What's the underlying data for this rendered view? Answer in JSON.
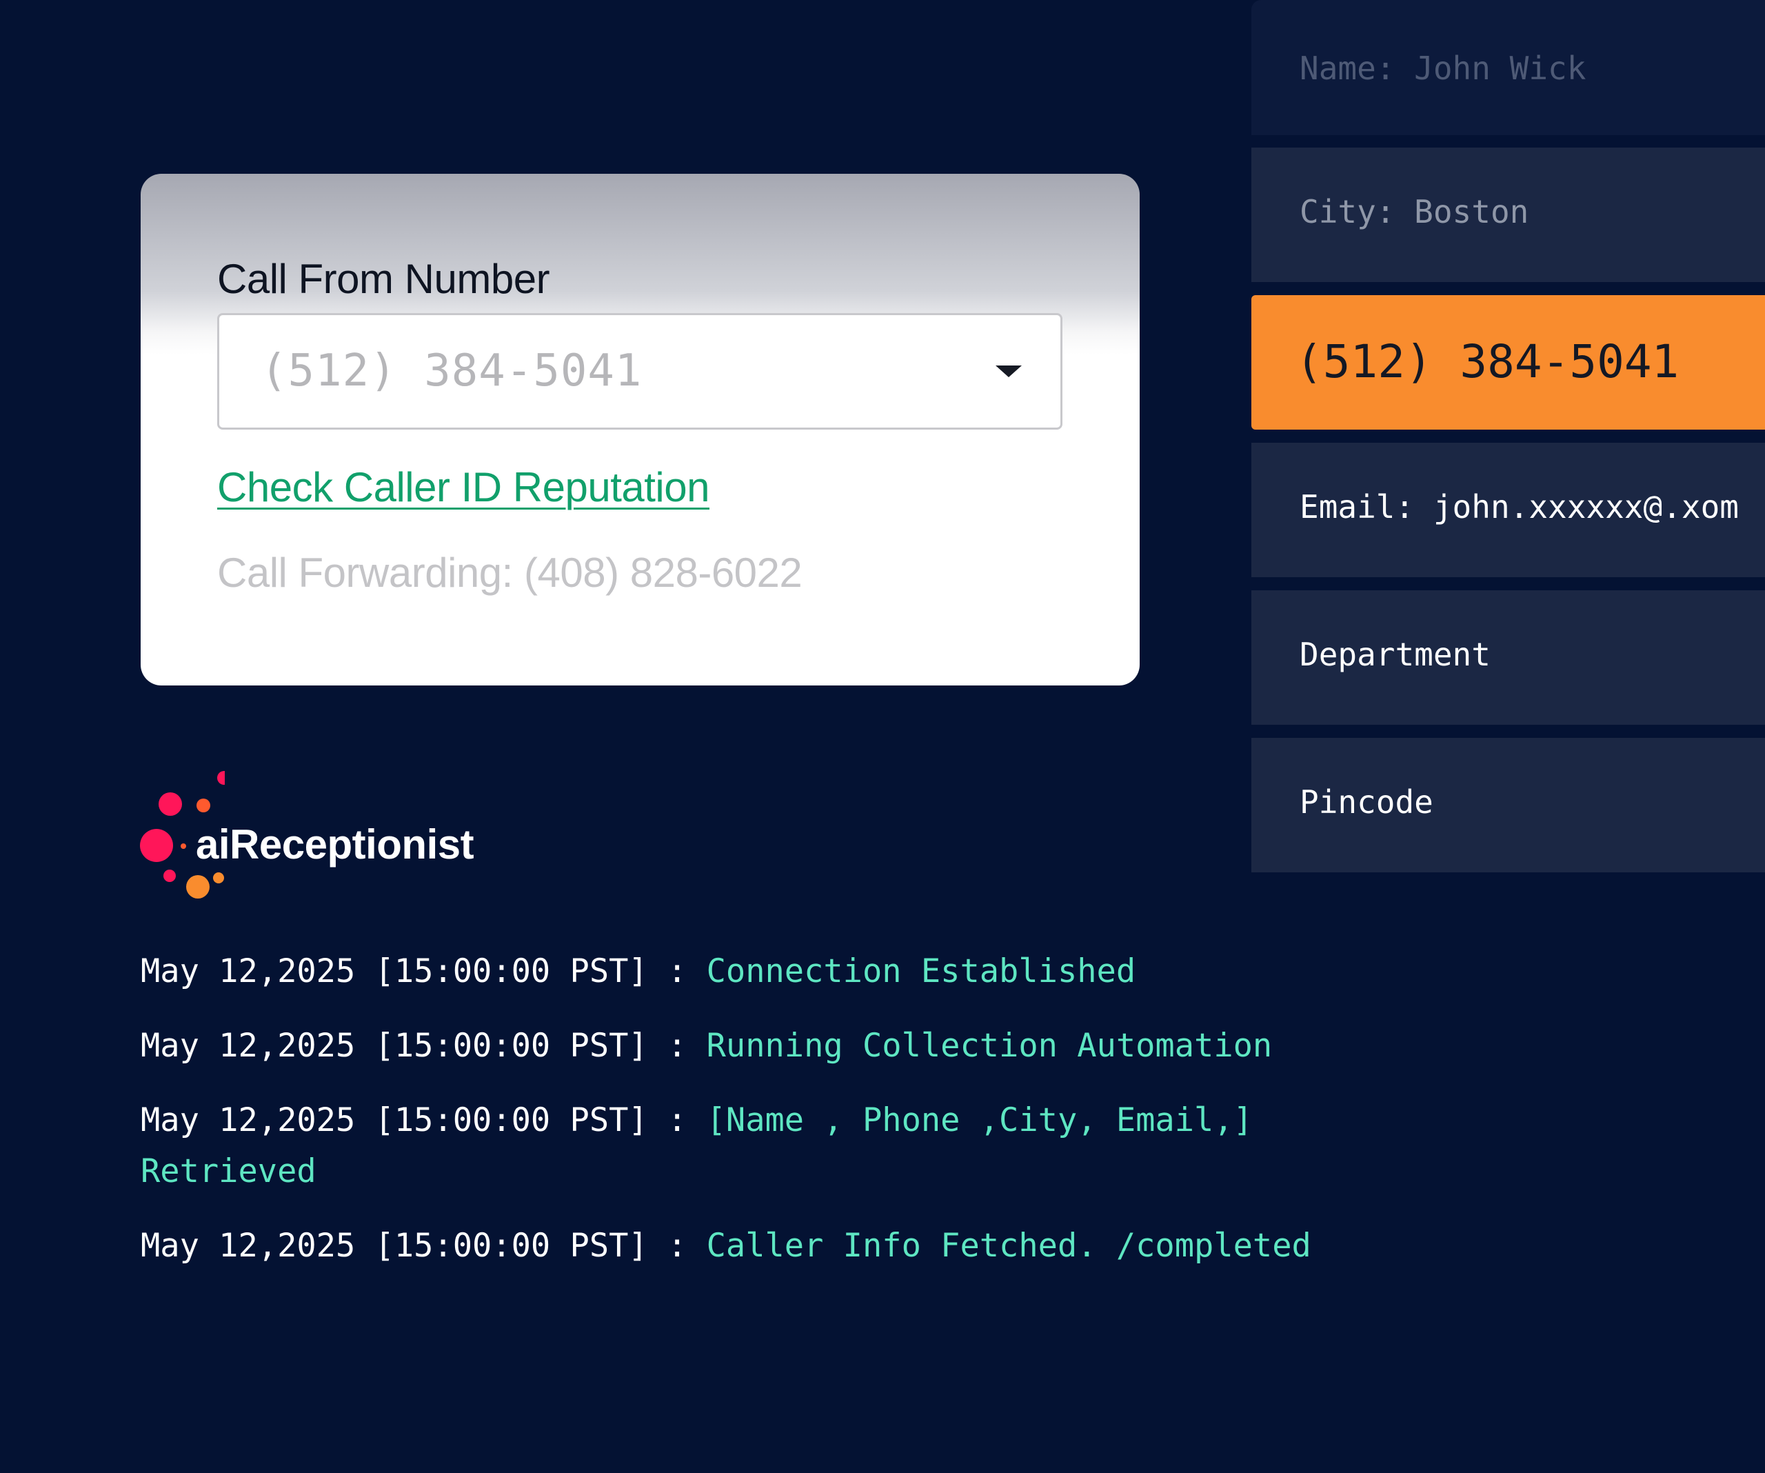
{
  "call_card": {
    "label": "Call From Number",
    "selected_number": "(512) 384-5041",
    "reputation_link": "Check Caller ID Reputation",
    "forwarding": "Call Forwarding: (408) 828-6022"
  },
  "caller_info": {
    "rows": [
      {
        "text": "Name: John Wick"
      },
      {
        "text": "City: Boston"
      },
      {
        "text": "(512) 384-5041"
      },
      {
        "text": "Email: john.xxxxxx@.xom"
      },
      {
        "text": "Department"
      },
      {
        "text": "Pincode"
      }
    ]
  },
  "brand": {
    "name": "aiReceptionist",
    "colors": {
      "accent_orange": "#f98c2e",
      "link_green": "#11a06b",
      "log_teal": "#5ee6c2",
      "logo_pink": "#ff1659",
      "background": "#041233"
    }
  },
  "log": {
    "separator": " : ",
    "entries": [
      {
        "timestamp": "May 12,2025 [15:00:00 PST]",
        "message": "Connection Established"
      },
      {
        "timestamp": "May 12,2025 [15:00:00 PST]",
        "message": "Running Collection Automation"
      },
      {
        "timestamp": "May 12,2025 [15:00:00 PST]",
        "message": "[Name , Phone ,City, Email,] Retrieved"
      },
      {
        "timestamp": "May 12,2025 [15:00:00 PST]",
        "message": "Caller Info Fetched. /completed"
      }
    ]
  }
}
